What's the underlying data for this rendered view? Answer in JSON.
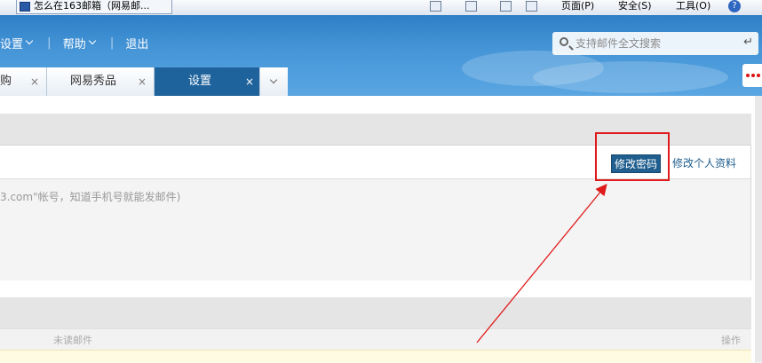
{
  "browser": {
    "tab_title": "怎么在163邮箱（网易邮...",
    "page_menu": "页面(P)",
    "safety_menu": "安全(S)",
    "tools_menu": "工具(O)",
    "help_icon": "?"
  },
  "nav": {
    "settings": "设置",
    "help": "帮助",
    "logout": "退出"
  },
  "search": {
    "placeholder": "支持邮件全文搜索",
    "enter_symbol": "↵"
  },
  "tabs": [
    {
      "label": "购",
      "close": "×"
    },
    {
      "label": "网易秀品",
      "close": "×"
    },
    {
      "label": "设置",
      "close": "×"
    }
  ],
  "account": {
    "hint": "3.com\"帐号，知道手机号就能发邮件)",
    "change_password": "修改密码",
    "edit_profile": "修改个人资料"
  },
  "table": {
    "col_unread": "未读邮件",
    "col_action": "操作"
  },
  "colors": {
    "header_blue": "#3a8ad0",
    "active_tab": "#1e639c",
    "highlight_red": "#e01a1a",
    "link_blue": "#1f5e8e"
  }
}
